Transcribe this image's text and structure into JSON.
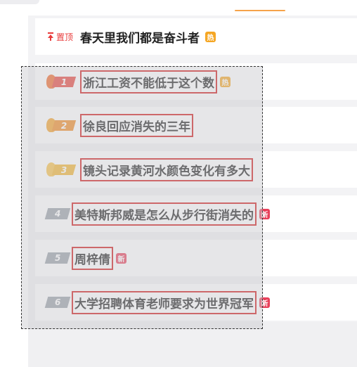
{
  "pinned": {
    "badge_label": "置顶",
    "title": "春天里我们都是奋斗者",
    "tag": "热"
  },
  "hot_list": [
    {
      "rank": "1",
      "title": "浙江工资不能低于这个数",
      "tag": "热",
      "tag_type": "hot",
      "rank_color": "#e8453c",
      "flame_color": "#f06a2a"
    },
    {
      "rank": "2",
      "title": "徐良回应消失的三年",
      "tag": "",
      "tag_type": "",
      "rank_color": "#f08a24",
      "flame_color": "#f4a22a"
    },
    {
      "rank": "3",
      "title": "镜头记录黄河水颜色变化有多大",
      "tag": "",
      "tag_type": "",
      "rank_color": "#f2b431",
      "flame_color": "#f7c24a"
    },
    {
      "rank": "4",
      "title": "美特斯邦威是怎么从步行街消失的",
      "tag": "新",
      "tag_type": "new",
      "rank_color": "#9aa0a8"
    },
    {
      "rank": "5",
      "title": "周梓倩",
      "tag": "新",
      "tag_type": "new",
      "rank_color": "#9aa0a8"
    },
    {
      "rank": "6",
      "title": "大学招聘体育老师要求为世界冠军",
      "tag": "新",
      "tag_type": "new",
      "rank_color": "#9aa0a8"
    }
  ],
  "colors": {
    "accent": "#f6a34a",
    "highlight_box": "#d11a1a",
    "hot_tag": "#f5a623",
    "new_tag": "#e8405a"
  }
}
